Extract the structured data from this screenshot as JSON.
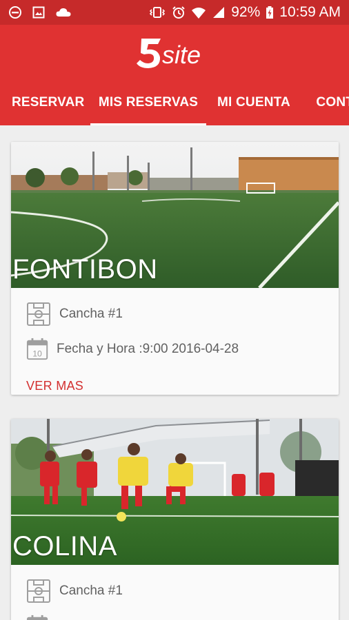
{
  "status_bar": {
    "battery": "92%",
    "time": "10:59 AM"
  },
  "app": {
    "logo_text": "5site",
    "colors": {
      "primary": "#e03232",
      "status": "#c62a2a",
      "accent": "#d32f2f"
    }
  },
  "tabs": [
    {
      "label": "RESERVAR"
    },
    {
      "label": "MIS RESERVAS",
      "active": true
    },
    {
      "label": "MI CUENTA"
    },
    {
      "label": "CONTA"
    }
  ],
  "reservations": [
    {
      "venue": "FONTIBON",
      "field": "Cancha #1",
      "datetime": "Fecha y Hora :9:00 2016-04-28",
      "calendar_day": "10",
      "more_label": "VER MAS"
    },
    {
      "venue": "COLINA",
      "field": "Cancha #1"
    }
  ]
}
